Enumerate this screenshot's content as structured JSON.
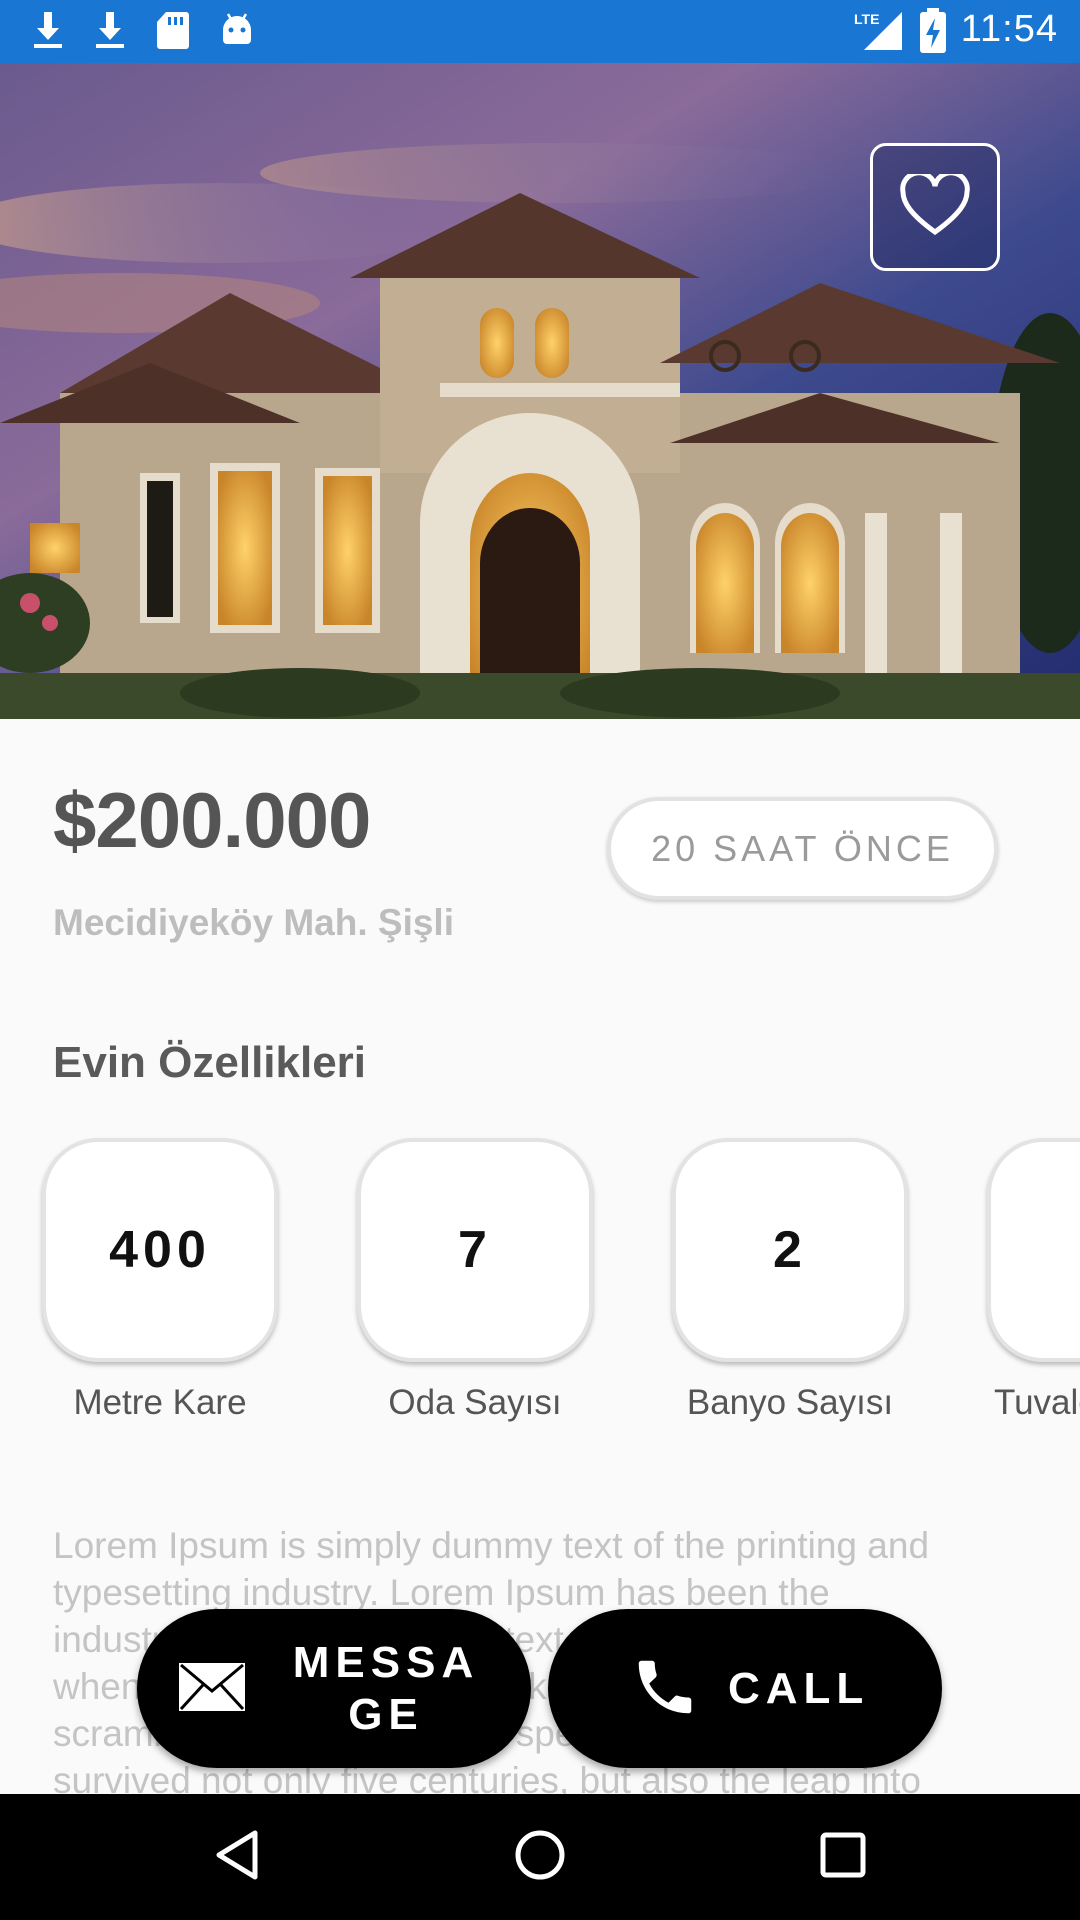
{
  "status_bar": {
    "time": "11:54",
    "network": "LTE",
    "icons": [
      "download-icon",
      "download-icon",
      "sd-card-icon",
      "android-icon",
      "lte-signal-icon",
      "battery-charging-icon"
    ],
    "background": "#1976d2"
  },
  "listing": {
    "price": "$200.000",
    "posted": "20 SAAT ÖNCE",
    "location": "Mecidiyeköy Mah. Şişli",
    "favorite_icon": "heart-outline-icon"
  },
  "features": {
    "title": "Evin Özellikleri",
    "items": [
      {
        "value": "400",
        "label": "Metre Kare"
      },
      {
        "value": "7",
        "label": "Oda Sayısı"
      },
      {
        "value": "2",
        "label": "Banyo Sayısı"
      },
      {
        "value": "",
        "label": "Tuvalet"
      }
    ]
  },
  "description": "Lorem Ipsum is simply dummy text of the printing and typesetting industry. Lorem Ipsum has been the industry's standard dummy text ever since the 1500s, when an unknown printer took a galley of type and scrambled it to make a type specimen book. It has survived not only five centuries, but also the leap into",
  "actions": {
    "message_label": "MESSAGE",
    "call_label": "CALL"
  },
  "nav_bar": {
    "icons": [
      "back-icon",
      "home-icon",
      "recents-icon"
    ]
  }
}
